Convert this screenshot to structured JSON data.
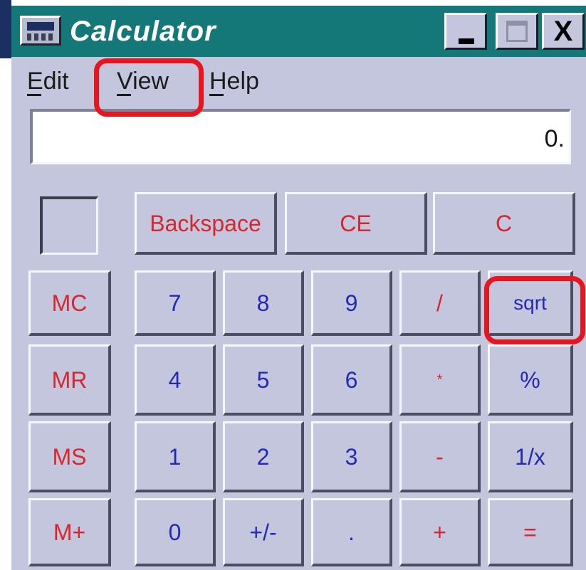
{
  "window": {
    "title": "Calculator",
    "minimize_icon": "minimize-icon",
    "maximize_icon": "maximize-icon",
    "close_label": "X"
  },
  "menu": {
    "edit": "Edit",
    "view": "View",
    "help": "Help"
  },
  "display": {
    "value": "0."
  },
  "colors": {
    "title_bar": "#157878",
    "window_face": "#c3c6dc",
    "key_text_red": "#d8262f",
    "key_text_blue": "#2229b8",
    "highlight": "#e8141e"
  },
  "keys": {
    "backspace": "Backspace",
    "ce": "CE",
    "c": "C",
    "mc": "MC",
    "mr": "MR",
    "ms": "MS",
    "mplus": "M+",
    "n7": "7",
    "n8": "8",
    "n9": "9",
    "divide": "/",
    "sqrt": "sqrt",
    "n4": "4",
    "n5": "5",
    "n6": "6",
    "multiply": "*",
    "percent": "%",
    "n1": "1",
    "n2": "2",
    "n3": "3",
    "minus": "-",
    "reciprocal": "1/x",
    "n0": "0",
    "plusminus": "+/-",
    "decimal": ".",
    "plus": "+",
    "equals": "="
  }
}
